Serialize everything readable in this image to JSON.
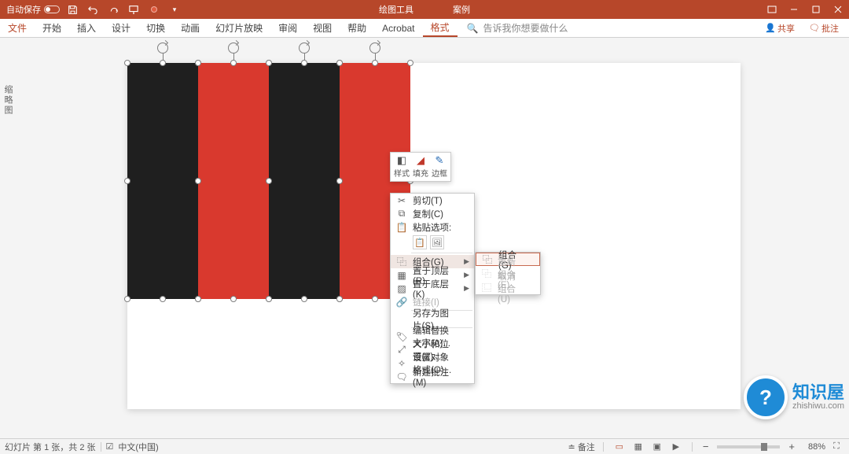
{
  "titlebar": {
    "autosave_label": "自动保存",
    "context_tab": "绘图工具",
    "doc_title": "案例"
  },
  "tabs": {
    "file": "文件",
    "home": "开始",
    "insert": "插入",
    "design": "设计",
    "transitions": "切换",
    "animations": "动画",
    "slideshow": "幻灯片放映",
    "review": "审阅",
    "view": "视图",
    "help": "帮助",
    "acrobat": "Acrobat",
    "format": "格式",
    "tellme_placeholder": "告诉我你想要做什么",
    "share": "共享",
    "comments": "批注"
  },
  "left_dock": "缩略图",
  "mini_toolbar": {
    "style": "样式",
    "fill": "填充",
    "outline": "边框"
  },
  "context_menu": {
    "cut": "剪切(T)",
    "copy": "复制(C)",
    "paste_options": "粘贴选项:",
    "group": "组合(G)",
    "bring_front": "置于顶层(R)",
    "send_back": "置于底层(K)",
    "link": "链接(I)",
    "save_as_pic": "另存为图片(S)...",
    "alt_text": "编辑替换文字(A)...",
    "size_pos": "大小和位置(Z)...",
    "format_obj": "设置对象格式(O)...",
    "new_comment": "新建批注(M)"
  },
  "submenu": {
    "group": "组合(G)",
    "regroup": "重新组合(E)",
    "ungroup": "取消组合(U)"
  },
  "statusbar": {
    "slide_info": "幻灯片 第 1 张，共 2 张",
    "lang": "中文(中国)",
    "notes": "备注",
    "zoom_pct": "88%"
  },
  "watermark": {
    "brand": "知识屋",
    "domain": "zhishiwu.com",
    "icon": "?"
  }
}
